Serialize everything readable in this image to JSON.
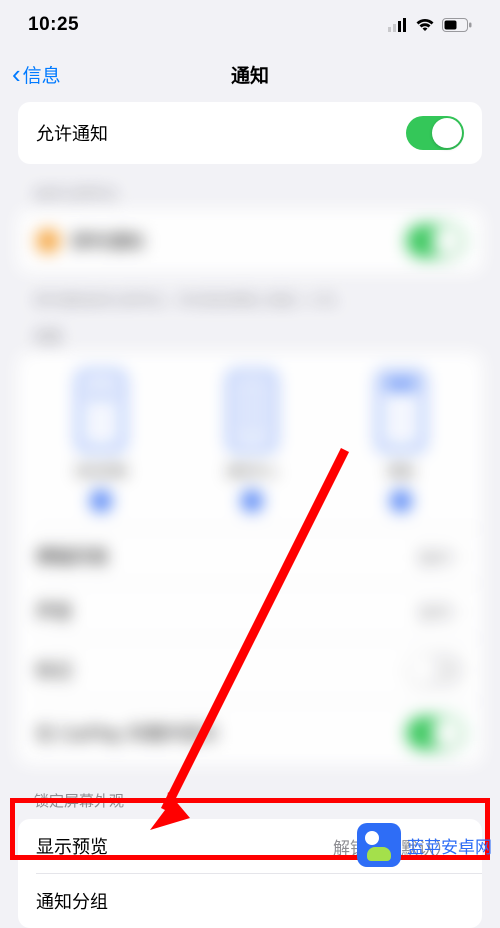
{
  "status": {
    "time": "10:25"
  },
  "nav": {
    "back": "信息",
    "title": "通知"
  },
  "rows": {
    "allow": "允许通知",
    "time_sensitive_header": "始终立即传达",
    "time_sensitive": "即时通知",
    "time_sensitive_foot": "即时通知始终立即传达，并在锁定屏幕上保留 1 小时。",
    "alerts_header": "提醒",
    "opt_lock": "锁定屏幕",
    "opt_center": "通知中心",
    "opt_banner": "横幅",
    "banner_style": "横幅风格",
    "banner_style_val": "临时",
    "sounds": "声音",
    "sounds_val": "音符",
    "badges": "标记",
    "carplay": "在 CarPlay 车载中显示"
  },
  "lock": {
    "header": "锁定屏幕外观",
    "preview": "显示预览",
    "preview_val": "解锁时（默认）",
    "group": "通知分组"
  },
  "watermark": {
    "text": "蓝苹安卓网"
  }
}
